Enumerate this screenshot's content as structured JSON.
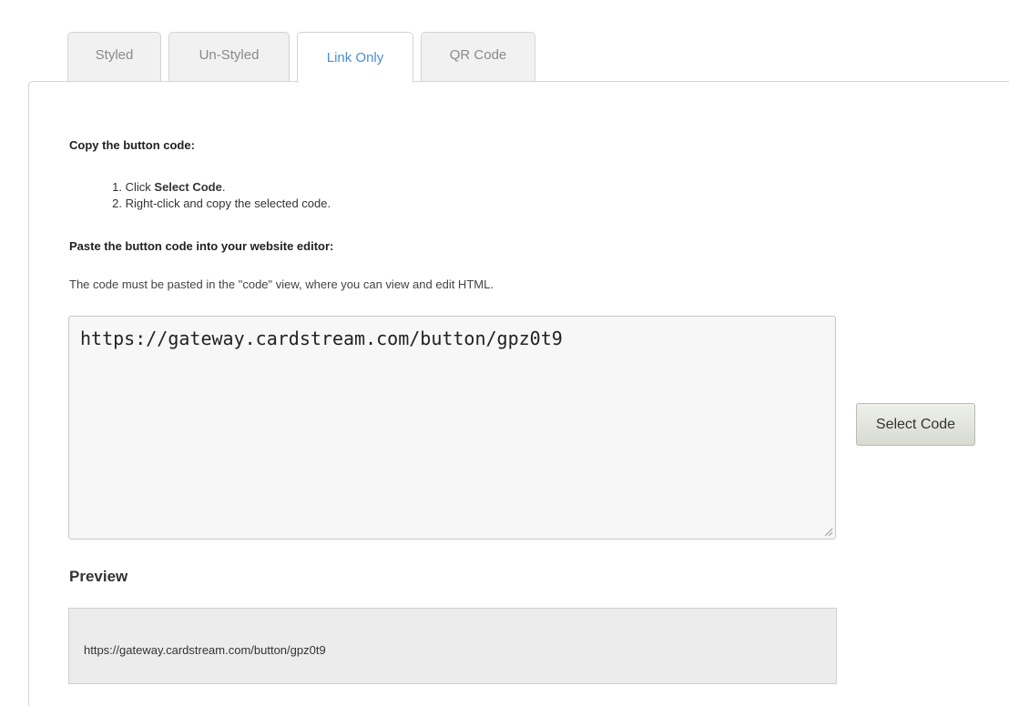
{
  "tabs": [
    {
      "label": "Styled",
      "active": false
    },
    {
      "label": "Un-Styled",
      "active": false
    },
    {
      "label": "Link Only",
      "active": true
    },
    {
      "label": "QR Code",
      "active": false
    }
  ],
  "copy_section": {
    "heading": "Copy the button code:",
    "steps": [
      {
        "num": "1.",
        "prefix": "Click ",
        "bold": "Select Code",
        "suffix": "."
      },
      {
        "num": "2.",
        "prefix": "Right-click and copy the selected code.",
        "bold": "",
        "suffix": ""
      }
    ]
  },
  "paste_section": {
    "heading": "Paste the button code into your website editor:",
    "note": "The code must be pasted in the \"code\" view, where you can view and edit HTML."
  },
  "code": {
    "value": "https://gateway.cardstream.com/button/gpz0t9"
  },
  "select_button": {
    "label": "Select Code"
  },
  "preview": {
    "heading": "Preview",
    "text": "https://gateway.cardstream.com/button/gpz0t9"
  },
  "colors": {
    "active_tab_text": "#4a8fd4",
    "inactive_tab_text": "#8a8a8a",
    "button_bg": "#d8dbd2"
  }
}
